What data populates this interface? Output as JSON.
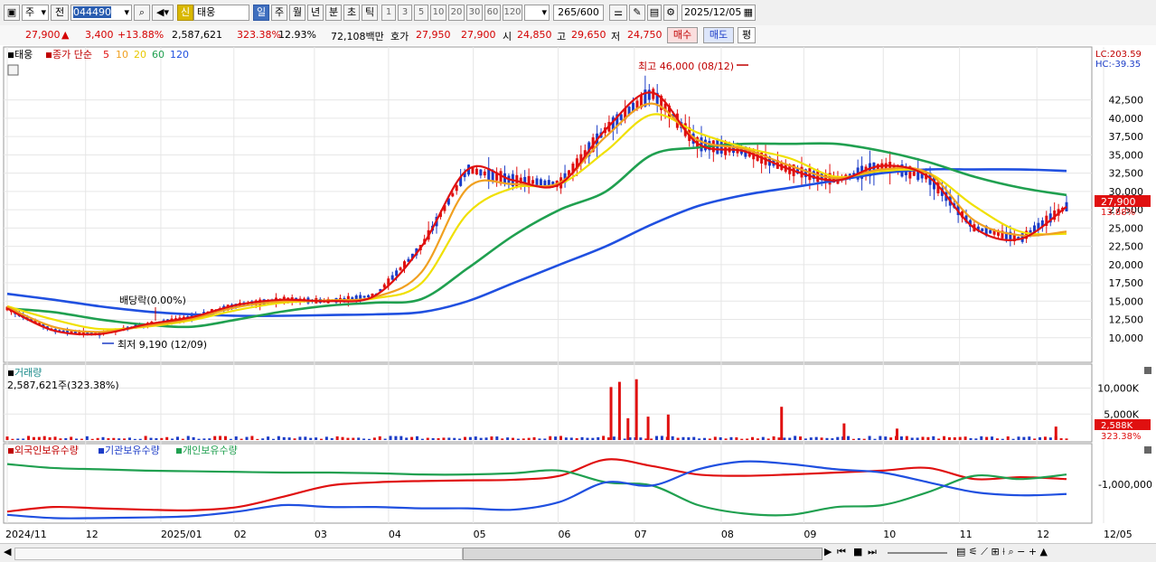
{
  "toolbar": {
    "type_label": "주",
    "all_label": "전",
    "code": "044490",
    "name": "태웅",
    "new_badge": "신",
    "periods": [
      "일",
      "주",
      "월",
      "년",
      "분",
      "초",
      "틱"
    ],
    "active_period": "일",
    "intervals": [
      "1",
      "3",
      "5",
      "10",
      "20",
      "30",
      "60",
      "120"
    ],
    "count": "265",
    "max_count": "/600",
    "date": "2025/12/05"
  },
  "quote": {
    "price": "27,900",
    "up_arrow": "▲",
    "change": "3,400",
    "change_pct": "+13.88%",
    "volume": "2,587,621",
    "volume_ratio": "323.38%",
    "turnover": "12.93%",
    "amount": "72,108백만",
    "bid_label": "호가",
    "bid_price": "27,950",
    "ask_price": "27,900",
    "open_label": "시",
    "open": "24,850",
    "high_label": "고",
    "high": "29,650",
    "low_label": "저",
    "low": "24,750",
    "buy_label": "매수",
    "sell_label": "매도",
    "eval_label": "평"
  },
  "legend": {
    "name": "태웅",
    "ma_title": "종가 단순",
    "ma_periods": [
      {
        "label": "5",
        "color": "#e01010"
      },
      {
        "label": "10",
        "color": "#f0a020"
      },
      {
        "label": "20",
        "color": "#e8d800"
      },
      {
        "label": "60",
        "color": "#20a050"
      },
      {
        "label": "120",
        "color": "#2050e0"
      }
    ],
    "lc": "LC:203.59",
    "hc": "HC:-39.35"
  },
  "annotations": {
    "high": "최고 46,000 (08/12)",
    "low": "최저 9,190 (12/09)",
    "dividend": "배당락(0.00%)"
  },
  "volume_panel": {
    "title": "거래량",
    "value": "2,587,621주(323.38%)",
    "ticks": [
      "10,000K",
      "5,000K"
    ],
    "last_label": "2,588K",
    "last_pct": "323.38%"
  },
  "holders_panel": {
    "series": [
      "외국인보유수량",
      "기관보유수량",
      "개인보유수량"
    ],
    "tick": "-1,000,000"
  },
  "colors": {
    "up": "#e01010",
    "down": "#1c3cc7",
    "ma5": "#e01010",
    "ma10": "#f0a020",
    "ma20": "#e8d800",
    "ma60": "#20a050",
    "ma120": "#2050e0"
  },
  "chart_data": [
    {
      "type": "line",
      "title": "태웅",
      "subtitle": "종가 단순 5 10 20 60 120",
      "x": [
        "2024/11",
        "12",
        "2025/01",
        "02",
        "03",
        "04",
        "05",
        "06",
        "07",
        "08",
        "09",
        "10",
        "11",
        "12",
        "12/05"
      ],
      "ylim": [
        8000,
        48500
      ],
      "yticks": [
        10000,
        12500,
        15000,
        17500,
        20000,
        22500,
        25000,
        27500,
        30000,
        32500,
        35000,
        37500,
        40000,
        42500
      ],
      "series": [
        {
          "name": "5",
          "values": [
            14000,
            11000,
            10500,
            11800,
            12800,
            14500,
            15200,
            15000,
            15800,
            22500,
            33000,
            31500,
            31000,
            38500,
            43500,
            36500,
            35500,
            33000,
            31500,
            33500,
            32000,
            25000,
            23500,
            27900
          ]
        },
        {
          "name": "10",
          "values": [
            14200,
            11500,
            10800,
            11600,
            12600,
            14200,
            15000,
            15100,
            15600,
            19000,
            30500,
            31000,
            31200,
            37500,
            42000,
            37000,
            35800,
            33500,
            31800,
            33000,
            32500,
            26000,
            24000,
            24500
          ]
        },
        {
          "name": "20",
          "values": [
            14300,
            12500,
            11200,
            11500,
            12400,
            13800,
            14800,
            15100,
            15400,
            17500,
            27000,
            30500,
            31000,
            35500,
            40500,
            38000,
            36000,
            34500,
            32000,
            32800,
            32500,
            28000,
            24500,
            24200
          ]
        },
        {
          "name": "60",
          "values": [
            14000,
            13500,
            12500,
            11800,
            11500,
            12500,
            13600,
            14400,
            14800,
            15300,
            19500,
            24000,
            27500,
            30000,
            35000,
            36000,
            36500,
            36500,
            36500,
            35500,
            34000,
            32000,
            30500,
            29500
          ]
        },
        {
          "name": "120",
          "values": [
            16000,
            15200,
            14300,
            13600,
            13200,
            13000,
            13000,
            13100,
            13200,
            13500,
            15000,
            17500,
            20000,
            22500,
            25500,
            28000,
            29500,
            30500,
            31500,
            32500,
            33000,
            33000,
            33000,
            32800
          ]
        }
      ],
      "high": {
        "label": "최고 46,000 (08/12)",
        "value": 46000
      },
      "low": {
        "label": "최저 9,190 (12/09)",
        "value": 9190
      },
      "last": {
        "value": 27900,
        "label": "27,900",
        "pct": "13.88%"
      }
    },
    {
      "type": "bar",
      "title": "거래량",
      "ylim": [
        0,
        12000
      ],
      "yticks": [
        5000,
        10000
      ],
      "spikes": [
        {
          "t": 0.57,
          "v": 10200
        },
        {
          "t": 0.578,
          "v": 11200
        },
        {
          "t": 0.586,
          "v": 4200
        },
        {
          "t": 0.594,
          "v": 11700
        },
        {
          "t": 0.605,
          "v": 4500
        },
        {
          "t": 0.624,
          "v": 4900
        },
        {
          "t": 0.731,
          "v": 6400
        },
        {
          "t": 0.79,
          "v": 3200
        },
        {
          "t": 0.84,
          "v": 2200
        },
        {
          "t": 0.99,
          "v": 2588
        }
      ],
      "last": {
        "label": "2,588K",
        "pct": "323.38%"
      }
    },
    {
      "type": "line",
      "title": "보유수량",
      "series": [
        {
          "name": "외국인보유수량",
          "values": [
            0.15,
            0.22,
            0.2,
            0.18,
            0.17,
            0.22,
            0.38,
            0.55,
            0.6,
            0.62,
            0.63,
            0.64,
            0.7,
            0.95,
            0.85,
            0.72,
            0.7,
            0.72,
            0.75,
            0.78,
            0.82,
            0.65,
            0.68,
            0.65
          ]
        },
        {
          "name": "기관보유수량",
          "values": [
            0.88,
            0.82,
            0.8,
            0.78,
            0.77,
            0.76,
            0.75,
            0.75,
            0.74,
            0.72,
            0.72,
            0.74,
            0.78,
            0.6,
            0.55,
            0.25,
            0.12,
            0.1,
            0.22,
            0.25,
            0.45,
            0.7,
            0.65,
            0.72
          ]
        },
        {
          "name": "개인보유수량",
          "values": [
            0.1,
            0.05,
            0.05,
            0.06,
            0.08,
            0.15,
            0.25,
            0.22,
            0.22,
            0.2,
            0.2,
            0.18,
            0.3,
            0.6,
            0.55,
            0.8,
            0.92,
            0.88,
            0.8,
            0.75,
            0.6,
            0.45,
            0.4,
            0.42
          ]
        }
      ]
    }
  ]
}
